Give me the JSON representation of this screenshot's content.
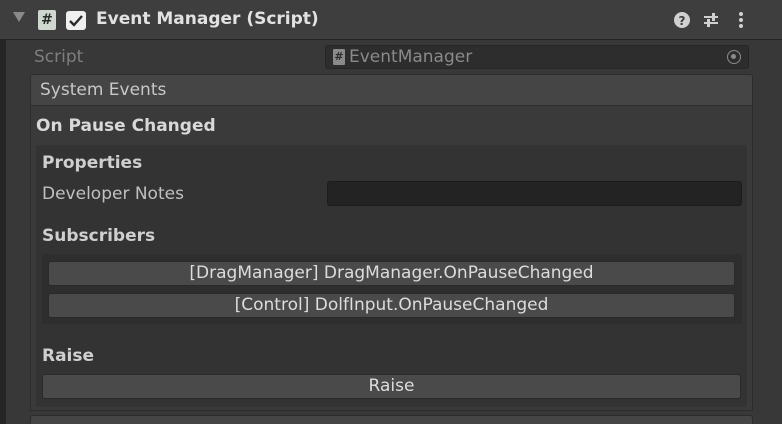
{
  "component": {
    "title": "Event Manager (Script)",
    "icon": "csharp-script-icon",
    "enabled": true,
    "header_icons": [
      "help-icon",
      "preset-icon",
      "kebab-menu-icon"
    ]
  },
  "script_field": {
    "label": "Script",
    "icon_glyph": "#",
    "value": "EventManager"
  },
  "system_events": {
    "title": "System Events",
    "event": {
      "name": "On Pause Changed",
      "properties_heading": "Properties",
      "notes_label": "Developer Notes",
      "notes_value": "",
      "subscribers_heading": "Subscribers",
      "subscribers": [
        "[DragManager] DragManager.OnPauseChanged",
        "[Control] DolfInput.OnPauseChanged"
      ],
      "raise_heading": "Raise",
      "raise_button": "Raise"
    }
  },
  "colors": {
    "background": "#383838",
    "header": "#3e3e3e",
    "button": "#4a4a4a",
    "field": "#232323"
  }
}
